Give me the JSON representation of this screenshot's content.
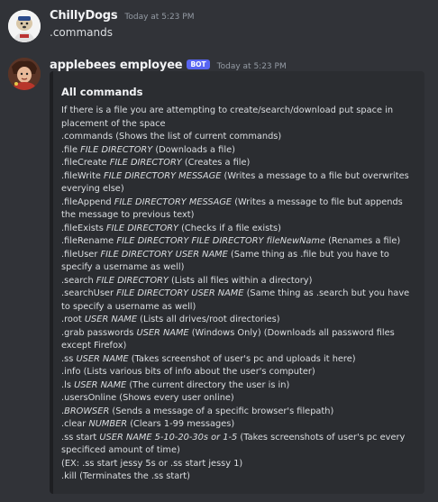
{
  "messages": [
    {
      "username": "ChillyDogs",
      "timestamp": "Today at 5:23 PM",
      "content": ".commands"
    },
    {
      "username": "applebees employee",
      "badge": "BOT",
      "timestamp": "Today at 5:23 PM",
      "embed": {
        "title": "All commands",
        "lines": [
          "If there is a file you are attempting to create/search/download put space in placement of the space",
          ".commands (Shows the list of current commands)",
          ".file FILE DIRECTORY (Downloads a file)",
          ".fileCreate FILE DIRECTORY (Creates a file)",
          ".fileWrite FILE DIRECTORY MESSAGE (Writes a message to a file but overwrites everying else)",
          ".fileAppend FILE DIRECTORY MESSAGE (Writes a message to file but appends the message to previous text)",
          ".fileExists FILE DIRECTORY (Checks if a file exists)",
          ".fileRename FILE DIRECTORY FILE DIRECTORY fileNewName (Renames a file)",
          ".fileUser FILE DIRECTORY USER NAME (Same thing as .file but you have to specify a username as well)",
          ".search FILE DIRECTORY (Lists all files within a directory)",
          ".searchUser FILE DIRECTORY USER NAME (Same thing as .search but you have to specify a username as well)",
          ".root USER NAME (Lists all drives/root directories)",
          ".grab passwords USER NAME (Windows Only) (Downloads all password files except Firefox)",
          ".ss USER NAME (Takes screenshot of user's pc and uploads it here)",
          ".info (Lists various bits of info about the user's computer)",
          ".ls USER NAME (The current directory the user is in)",
          ".usersOnline (Shows every user online)",
          ".BROWSER (Sends a message of a specific browser's filepath)",
          ".clear NUMBER (Clears 1-99 messages)",
          ".ss start USER NAME 5-10-20-30s or 1-5 (Takes screenshots of user's pc every specificed amount of time)",
          "(EX: .ss start jessy 5s or .ss start jessy 1)",
          ".kill (Terminates the .ss start)"
        ]
      }
    }
  ]
}
